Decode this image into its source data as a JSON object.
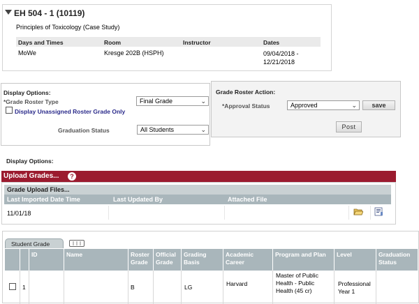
{
  "class_section": {
    "title": "EH 504 - 1 (10119)",
    "subtitle": "Principles of Toxicology (Case Study)",
    "columns": [
      "Days and Times",
      "Room",
      "Instructor",
      "Dates"
    ],
    "row": {
      "days": "MoWe",
      "room": "Kresge 202B (HSPH)",
      "instructor": "",
      "dates": "09/04/2018 - 12/21/2018"
    }
  },
  "display_options": {
    "heading": "Display Options:",
    "roster_type_label": "*Grade Roster Type",
    "roster_type_value": "Final Grade",
    "unassigned_label": "Display Unassigned Roster Grade Only",
    "grad_status_label": "Graduation Status",
    "grad_status_value": "All Students"
  },
  "roster_action": {
    "heading": "Grade Roster Action:",
    "approval_label": "*Approval Status",
    "approval_value": "Approved",
    "save_label": "save",
    "post_label": "Post"
  },
  "display_options_2": {
    "heading": "Display Options:"
  },
  "upload_grades": {
    "title": "Upload Grades...",
    "help_glyph": "?",
    "files_heading": "Grade Upload Files...",
    "columns": [
      "Last Imported Date Time",
      "Last Updated By",
      "Attached File"
    ],
    "row": {
      "imported": "11/01/18",
      "updated_by": "",
      "attached": ""
    }
  },
  "student_grade": {
    "tab_label": "Student Grade",
    "columns": [
      "ID",
      "Name",
      "Roster Grade",
      "Official Grade",
      "Grading Basis",
      "Academic Career",
      "Program and Plan",
      "Level",
      "Graduation Status"
    ],
    "rows": [
      {
        "num": "1",
        "id": "",
        "name": "",
        "roster_grade": "B",
        "official_grade": "",
        "grading_basis": "LG",
        "career": "Harvard",
        "program": "Master of Public Health - Public Health (45 cr)",
        "level": "Professional Year 1",
        "grad_status": ""
      }
    ]
  },
  "colors": {
    "accent_red": "#9b1b2f",
    "grid_header": "#a9b6bb",
    "subheader": "#c9d1d3"
  }
}
